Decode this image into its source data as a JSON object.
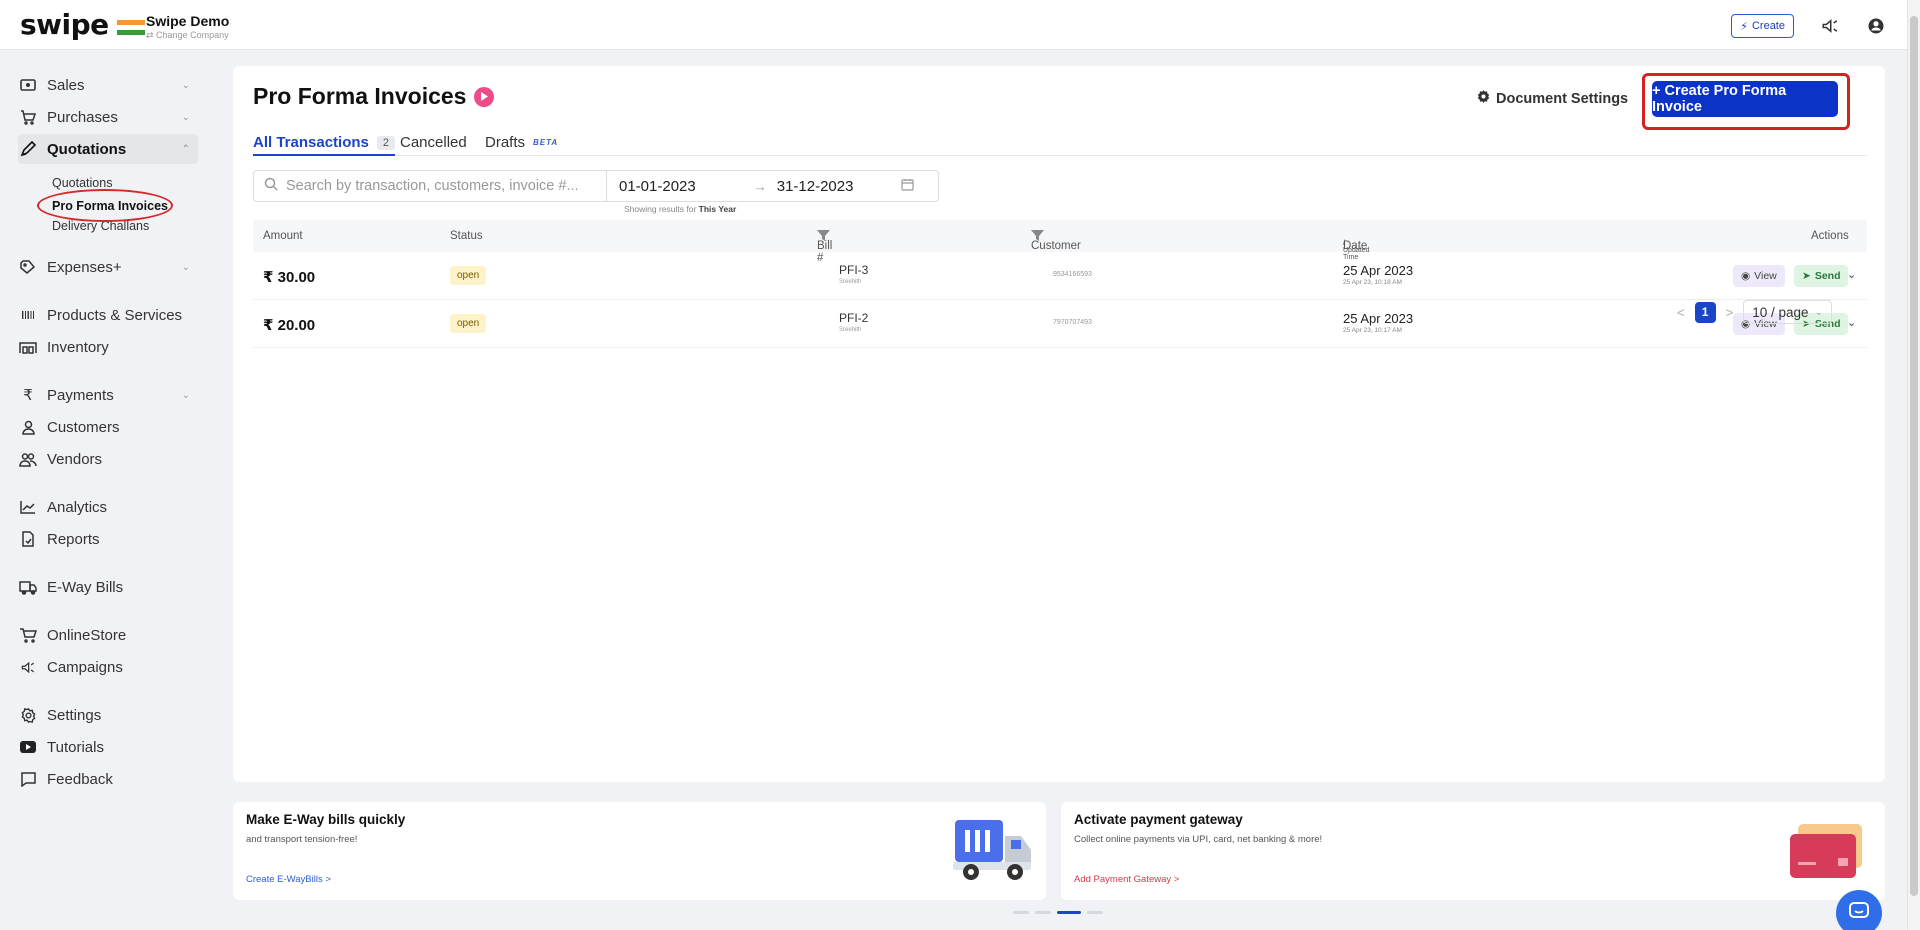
{
  "topbar": {
    "logo": "swipe",
    "company_name": "Swipe Demo",
    "change_company": "⇄ Change Company",
    "create_label": "Create"
  },
  "sidebar": {
    "items": [
      {
        "label": "Sales",
        "icon": "cash-icon",
        "expandable": true
      },
      {
        "label": "Purchases",
        "icon": "cart-icon",
        "expandable": true
      },
      {
        "label": "Quotations",
        "icon": "pen-icon",
        "expandable": true,
        "expanded": true
      },
      {
        "label": "Expenses+",
        "icon": "tag-icon",
        "expandable": true
      },
      {
        "label": "Products & Services",
        "icon": "barcode-icon",
        "expandable": false
      },
      {
        "label": "Inventory",
        "icon": "warehouse-icon",
        "expandable": false
      },
      {
        "label": "Payments",
        "icon": "rupee-icon",
        "expandable": true
      },
      {
        "label": "Customers",
        "icon": "user-icon",
        "expandable": false
      },
      {
        "label": "Vendors",
        "icon": "users-icon",
        "expandable": false
      },
      {
        "label": "Analytics",
        "icon": "chart-line-icon",
        "expandable": false
      },
      {
        "label": "Reports",
        "icon": "report-icon",
        "expandable": false
      },
      {
        "label": "E-Way Bills",
        "icon": "truck-icon",
        "expandable": false
      },
      {
        "label": "OnlineStore",
        "icon": "store-cart-icon",
        "expandable": false
      },
      {
        "label": "Campaigns",
        "icon": "megaphone-icon",
        "expandable": false
      },
      {
        "label": "Settings",
        "icon": "gear-icon",
        "expandable": false
      },
      {
        "label": "Tutorials",
        "icon": "youtube-icon",
        "expandable": false
      },
      {
        "label": "Feedback",
        "icon": "chat-icon",
        "expandable": false
      }
    ],
    "quotation_subitems": [
      "Quotations",
      "Pro Forma Invoices",
      "Delivery Challans"
    ]
  },
  "main": {
    "title": "Pro Forma Invoices",
    "document_settings": "Document Settings",
    "create_button": "+ Create Pro Forma Invoice",
    "tabs": [
      {
        "label": "All Transactions",
        "count": "2"
      },
      {
        "label": "Cancelled"
      },
      {
        "label": "Drafts",
        "badge": "BETA"
      }
    ],
    "search_placeholder": "Search by transaction, customers, invoice #...",
    "date_from": "01-01-2023",
    "date_to": "31-12-2023",
    "date_hint_prefix": "Showing results for",
    "date_hint_value": "This Year",
    "columns": {
      "amount": "Amount",
      "status": "Status",
      "bill": "Bill #",
      "customer": "Customer",
      "date": "Date",
      "date_sub": "/ Updated Time",
      "actions": "Actions"
    },
    "rows": [
      {
        "amount": "₹ 30.00",
        "status": "open",
        "bill": "PFI-3",
        "bill_by": "Sreehith",
        "customer": "9534166593",
        "date": "25 Apr 2023",
        "updated": "25 Apr 23, 10:18 AM"
      },
      {
        "amount": "₹ 20.00",
        "status": "open",
        "bill": "PFI-2",
        "bill_by": "Sreehith",
        "customer": "7970707493",
        "date": "25 Apr 2023",
        "updated": "25 Apr 23, 10:17 AM"
      }
    ],
    "view_label": "View",
    "send_label": "Send",
    "current_page": "1",
    "page_size": "10 / page"
  },
  "promos": [
    {
      "title": "Make E-Way bills quickly",
      "desc": "and transport tension-free!",
      "link": "Create E-WayBills >"
    },
    {
      "title": "Activate payment gateway",
      "desc": "Collect online payments via UPI, card, net banking & more!",
      "link": "Add Payment Gateway >"
    }
  ],
  "colors": {
    "primary": "#0b34c7",
    "highlight_ring": "#d42222",
    "status_open_bg": "#fcf3c9",
    "play_badge": "#ec4c8a"
  }
}
